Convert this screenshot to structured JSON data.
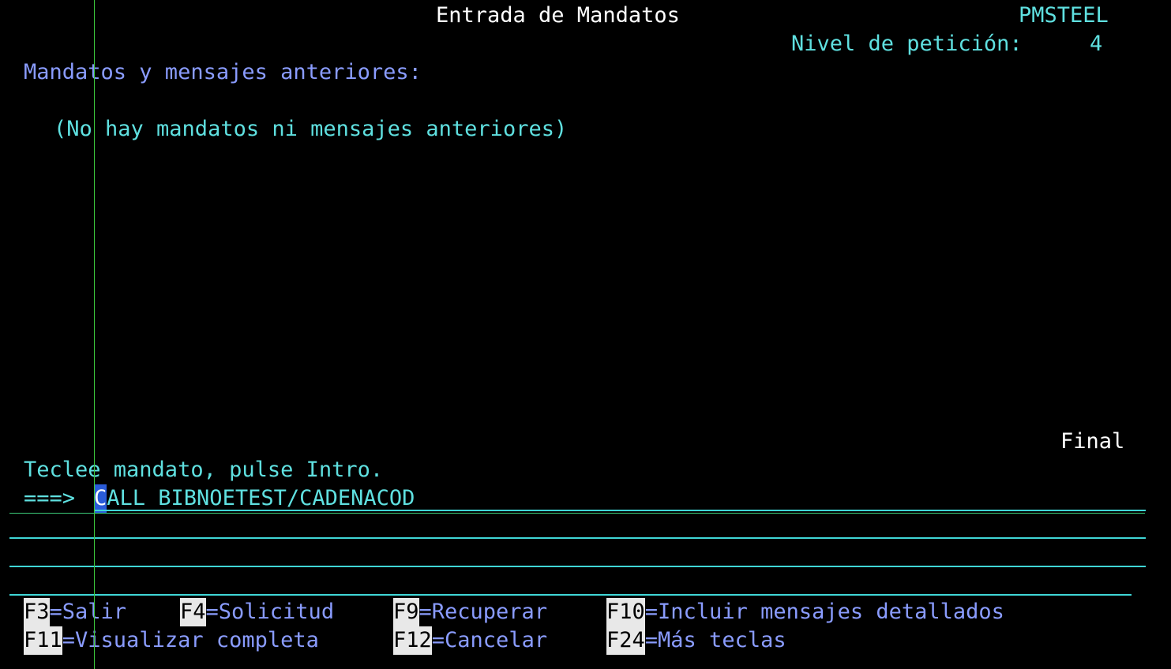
{
  "header": {
    "title": "Entrada de Mandatos",
    "system_name": "PMSTEEL",
    "request_level_label": "Nivel de petición:",
    "request_level_value": "4"
  },
  "history": {
    "heading": "Mandatos y mensajes anteriores:",
    "empty_message": "(No hay mandatos ni mensajes anteriores)",
    "scroll_indicator": "Final"
  },
  "command": {
    "instruction": "Teclee mandato, pulse Intro.",
    "prompt": "===>",
    "first_char": "C",
    "rest_value": "ALL BIBNOETEST/CADENACOD"
  },
  "function_keys": {
    "row1": [
      {
        "key": "F3",
        "label": "=Salir"
      },
      {
        "key": "F4",
        "label": "=Solicitud"
      },
      {
        "key": "F9",
        "label": "=Recuperar"
      },
      {
        "key": "F10",
        "label": "=Incluir mensajes detallados"
      }
    ],
    "row2": [
      {
        "key": "F11",
        "label": "=Visualizar completa"
      },
      {
        "key": "F12",
        "label": "=Cancelar"
      },
      {
        "key": "F24",
        "label": "=Más teclas"
      }
    ]
  },
  "colors": {
    "background": "#000000",
    "cyan": "#5fe0e0",
    "blue": "#8a9cff",
    "white": "#ffffff"
  }
}
